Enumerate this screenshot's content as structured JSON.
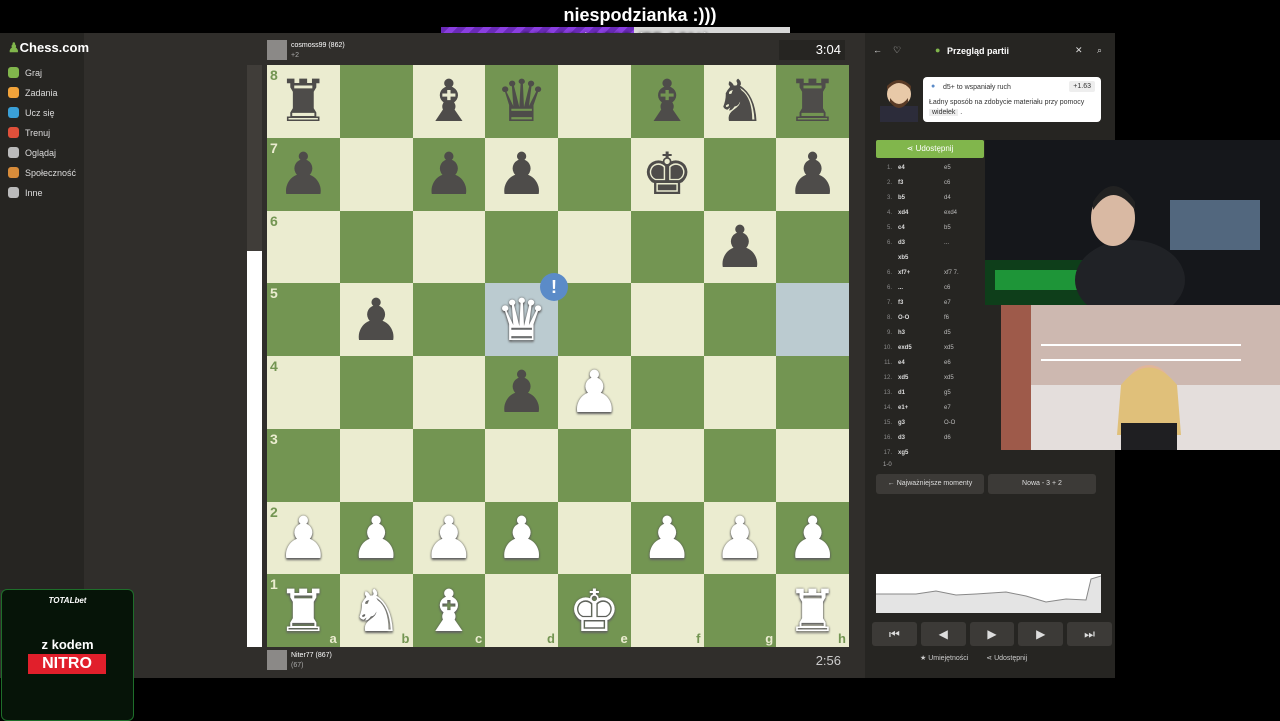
{
  "stream": {
    "title": "niespodzianka :)))",
    "goal_text": "562.63 / 1020 (55.16%)",
    "goal_fraction": 0.5516
  },
  "sidebar": {
    "logo_prefix": "",
    "logo": "Chess.com",
    "items": [
      {
        "label": "Graj",
        "color": "#81b64c"
      },
      {
        "label": "Zadania",
        "color": "#f2a33a"
      },
      {
        "label": "Ucz się",
        "color": "#3aa0d8"
      },
      {
        "label": "Trenuj",
        "color": "#e0503a"
      },
      {
        "label": "Oglądaj",
        "color": "#bbbbbb"
      },
      {
        "label": "Społeczność",
        "color": "#d88c3a"
      },
      {
        "label": "Inne",
        "color": "#bbbbbb"
      }
    ]
  },
  "top_player": {
    "name": "cosmoss99 (862)",
    "sub": "+2",
    "clock": "3:04"
  },
  "bottom_player": {
    "name": "Niter77 (867)",
    "sub": "(67)",
    "clock": "2:56"
  },
  "board": {
    "rows": [
      [
        "br",
        "",
        "bb",
        "bq",
        "",
        "bb",
        "bn",
        "br"
      ],
      [
        "bp",
        "",
        "bp",
        "bp",
        "",
        "bk",
        "",
        "bp"
      ],
      [
        "",
        "",
        "",
        "",
        "",
        "",
        "bp",
        ""
      ],
      [
        "",
        "bp",
        "",
        "wq",
        "",
        "",
        "",
        ""
      ],
      [
        "",
        "",
        "",
        "bp",
        "wp",
        "",
        "",
        ""
      ],
      [
        "",
        "",
        "",
        "",
        "",
        "",
        "",
        ""
      ],
      [
        "wp",
        "wp",
        "wp",
        "wp",
        "",
        "wp",
        "wp",
        "wp"
      ],
      [
        "wr",
        "wn",
        "wb",
        "",
        "wk",
        "",
        "",
        "wr"
      ]
    ],
    "highlight": [
      "d5",
      "h5"
    ],
    "ranks": [
      "8",
      "7",
      "6",
      "5",
      "4",
      "3",
      "2",
      "1"
    ],
    "files": [
      "a",
      "b",
      "c",
      "d",
      "e",
      "f",
      "g",
      "h"
    ],
    "annotation": "!"
  },
  "eval_white_fraction": 0.68,
  "review": {
    "title": "Przegląd partii",
    "coach_line1": "d5+ to wspaniały ruch",
    "coach_eval": "+1.63",
    "coach_line2": "Ładny sposób na zdobycie materiału przy pomocy",
    "coach_word": "widełek",
    "share_label": "Udostępnij",
    "moves": [
      {
        "n": "1.",
        "w": "e4",
        "b": "e5"
      },
      {
        "n": "2.",
        "w": "f3",
        "b": "c6"
      },
      {
        "n": "3.",
        "w": "b5",
        "b": "d4"
      },
      {
        "n": "4.",
        "w": "xd4",
        "b": "exd4"
      },
      {
        "n": "5.",
        "w": "c4",
        "b": "b5"
      },
      {
        "n": "6.",
        "w": "d3",
        "b": "..."
      },
      {
        "n": "",
        "w": "xb5",
        "b": ""
      },
      {
        "n": "6.",
        "w": "xf7+",
        "b": "xf7  7."
      },
      {
        "n": "6.",
        "w": "...",
        "b": "c6"
      },
      {
        "n": "7.",
        "w": "f3",
        "b": "e7"
      },
      {
        "n": "8.",
        "w": "O-O",
        "b": "f6"
      },
      {
        "n": "9.",
        "w": "h3",
        "b": "d5"
      },
      {
        "n": "10.",
        "w": "exd5",
        "b": "xd5"
      },
      {
        "n": "11.",
        "w": "e4",
        "b": "e6"
      },
      {
        "n": "12.",
        "w": "xd5",
        "b": "xd5"
      },
      {
        "n": "13.",
        "w": "d1",
        "b": "g5"
      },
      {
        "n": "14.",
        "w": "e1+",
        "b": "e7"
      },
      {
        "n": "15.",
        "w": "g3",
        "b": "O-O"
      },
      {
        "n": "16.",
        "w": "d3",
        "b": "d6"
      },
      {
        "n": "17.",
        "w": "xg5",
        "b": ""
      }
    ],
    "result": "1-0",
    "key_moments": "Najważniejsze momenty",
    "new_game": "Nowa - 3 + 2",
    "nav": [
      "⏮",
      "◀",
      "▶",
      "▶",
      "⏭"
    ],
    "skills": "Umiejętności",
    "share2": "Udostępnij"
  },
  "ad": {
    "brand": "TOTALbet",
    "line1": "z kodem",
    "code": "NITRO"
  },
  "colors": {
    "light": "#ebecd0",
    "dark": "#739552",
    "accent": "#81b64c"
  }
}
